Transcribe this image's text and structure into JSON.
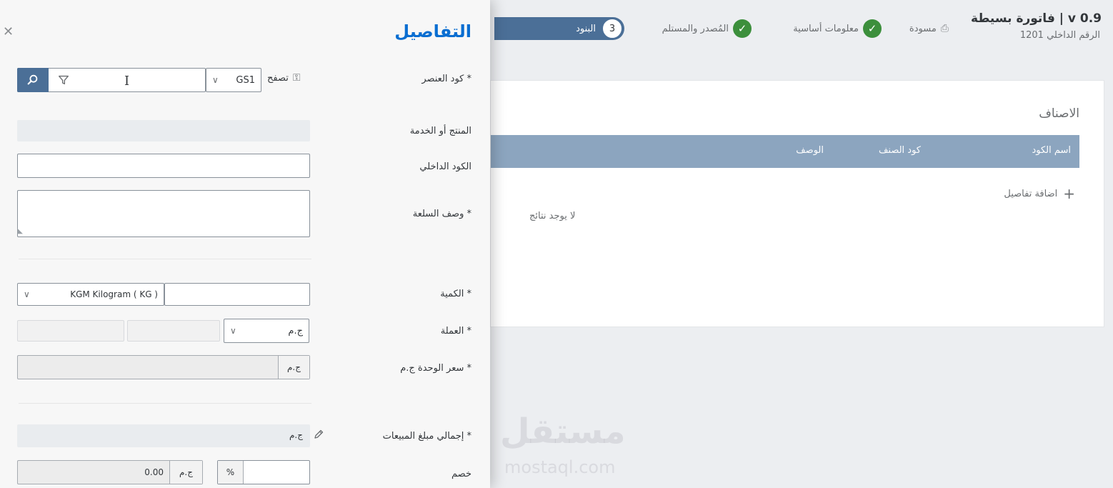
{
  "app": {
    "title": "فاتورة بسيطة | v 0.9",
    "subtitle": "الرقم الداخلي 1201"
  },
  "stepper": {
    "steps": [
      {
        "label": "مسودة",
        "state": "draft"
      },
      {
        "label": "معلومات أساسية",
        "state": "done"
      },
      {
        "label": "المُصدر والمستلم",
        "state": "done"
      },
      {
        "label": "البنود",
        "number": "3",
        "state": "active"
      }
    ]
  },
  "items_card": {
    "title": "الاصناف",
    "columns": [
      "اسم الكود",
      "كود الصنف",
      "الوصف"
    ],
    "add_details": "اضافة تفاصيل",
    "empty_text": "لا يوجد نتائج"
  },
  "watermark": {
    "text": "مستقل",
    "url": "mostaql.com"
  },
  "panel": {
    "title": "التفاصيل",
    "item_code_label": "كود العنصر *",
    "browse_label": "تصفح",
    "code_type_value": "GS1",
    "product_label": "المنتج أو الخدمة",
    "internal_code_label": "الكود الداخلي",
    "description_label": "وصف السلعة *",
    "quantity_label": "الكمية *",
    "unit_value": "KGM Kilogram ( KG )",
    "currency_label": "العملة *",
    "currency_value": "ج.م",
    "unit_price_label": "سعر الوحدة ج.م *",
    "unit_price_currency": "ج.م",
    "total_sales_label": "إجمالي مبلغ المبيعات *",
    "total_sales_currency": "ج.م",
    "discount_label": "خصم",
    "discount_value": "0.00",
    "discount_currency": "ج.م",
    "discount_percent": "%"
  },
  "colors": {
    "accent": "#4b6f97",
    "table_header": "#8ca5bf",
    "title_blue": "#0a6ed1",
    "success": "#3c8f3c"
  }
}
